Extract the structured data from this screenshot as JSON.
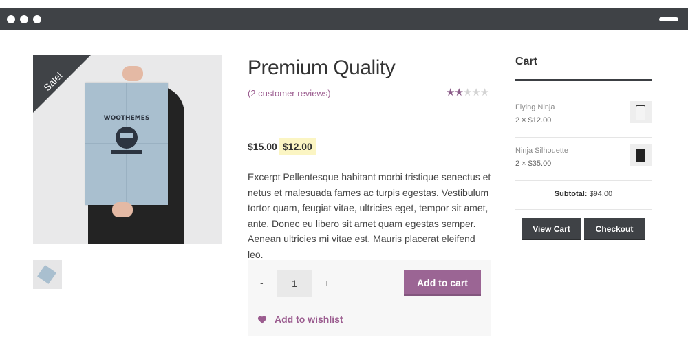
{
  "window": {
    "controls": [
      "dot",
      "dot",
      "dot"
    ],
    "menu_icon": "hamburger-icon"
  },
  "product": {
    "title": "Premium Quality",
    "reviews_link": "(2 customer reviews)",
    "rating": 2,
    "rating_max": 5,
    "sale_badge": "Sale!",
    "price_old": "$15.00",
    "price_new": "$12.00",
    "description": "Excerpt Pellentesque habitant morbi tristique senectus et netus et malesuada fames ac turpis egestas. Vestibulum tortor quam, feugiat vitae, ultricies eget, tempor sit amet, ante. Donec eu libero sit amet quam egestas semper. Aenean ultricies mi vitae est. Mauris placerat eleifend leo.",
    "quantity": "1",
    "qty_minus": "-",
    "qty_plus": "+",
    "add_to_cart_label": "Add to cart",
    "wishlist_label": "Add to wishlist",
    "poster_logo_text": "WOOTHEMES"
  },
  "cart": {
    "title": "Cart",
    "items": [
      {
        "name": "Flying Ninja",
        "qty_price": "2 × $12.00",
        "thumb": "white-shirt"
      },
      {
        "name": "Ninja Silhouette",
        "qty_price": "2 × $35.00",
        "thumb": "black-hoodie"
      }
    ],
    "subtotal_label": "Subtotal:",
    "subtotal_value": "$94.00",
    "view_cart_label": "View Cart",
    "checkout_label": "Checkout"
  },
  "colors": {
    "accent": "#9b6594",
    "dark": "#3f4246",
    "sale_highlight": "#fbf5c3"
  }
}
